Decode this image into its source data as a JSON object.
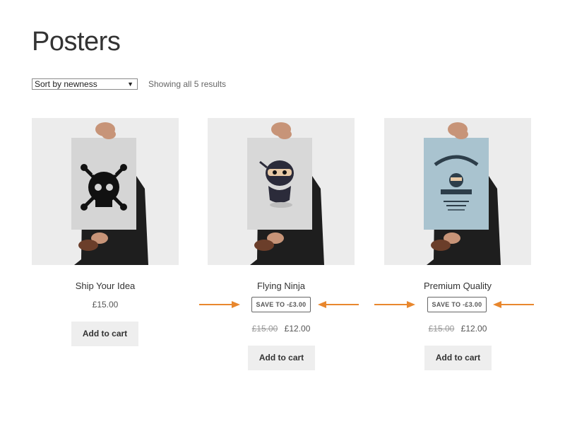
{
  "page": {
    "title": "Posters"
  },
  "toolbar": {
    "sort_value": "Sort by newness",
    "results_text": "Showing all 5 results"
  },
  "products": [
    {
      "name": "Ship Your Idea",
      "price": "£15.00",
      "button": "Add to cart"
    },
    {
      "name": "Flying Ninja",
      "badge": "SAVE TO -£3.00",
      "old_price": "£15.00",
      "sale_price": "£12.00",
      "button": "Add to cart"
    },
    {
      "name": "Premium Quality",
      "badge": "SAVE TO -£3.00",
      "old_price": "£15.00",
      "sale_price": "£12.00",
      "button": "Add to cart"
    }
  ],
  "colors": {
    "annotation_arrow": "#e8872e",
    "image_bg": "#ececec",
    "button_bg": "#eeeeee"
  }
}
